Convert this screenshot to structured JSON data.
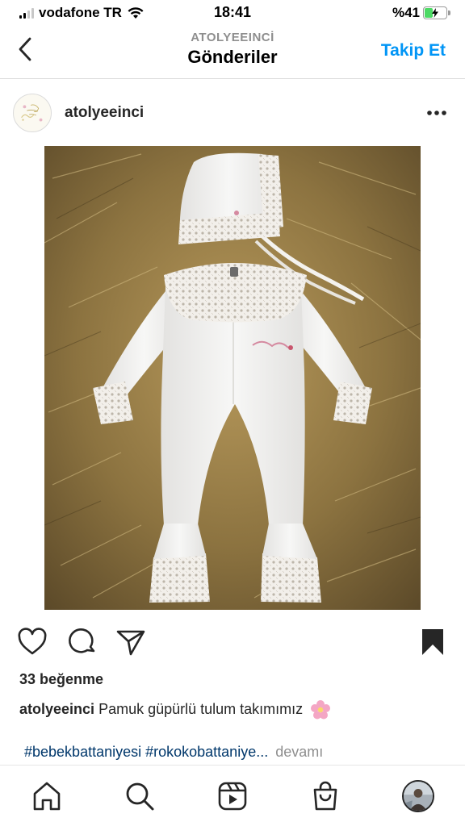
{
  "status_bar": {
    "carrier": "vodafone TR",
    "time": "18:41",
    "battery": "%41",
    "battery_level": 0.41
  },
  "header": {
    "subtitle": "ATOLYEEINCİ",
    "title": "Gönderiler",
    "follow_label": "Takip Et"
  },
  "post": {
    "username": "atolyeeinci",
    "likes": "33 beğenme",
    "caption_user": "atolyeeinci",
    "caption_text": "Pamuk güpürlü tulum takımımız",
    "hashtags": "#bebekbattaniyesi #rokokobattaniye...",
    "more_label": "devamı"
  },
  "icons": {
    "back": "chevron-left-icon",
    "more": "more-horizontal-icon",
    "like": "heart-icon",
    "comment": "comment-icon",
    "share": "send-icon",
    "save": "bookmark-icon",
    "home": "home-icon",
    "search": "search-icon",
    "reels": "reels-icon",
    "shop": "shop-icon"
  },
  "colors": {
    "accent": "#0095f6",
    "hashtag": "#00376b",
    "battery_green": "#4cd964"
  }
}
